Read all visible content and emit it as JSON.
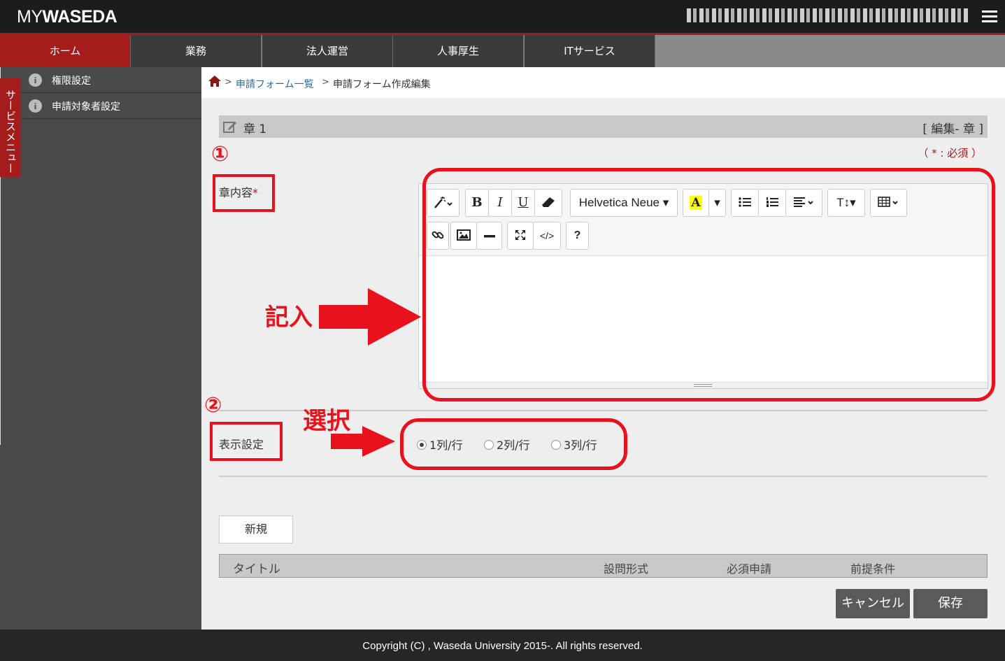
{
  "header": {
    "logo_thin": "MY",
    "logo_bold": "WASEDA"
  },
  "nav": {
    "items": [
      {
        "label": "ホーム",
        "active": true
      },
      {
        "label": "業務"
      },
      {
        "label": "法人運営"
      },
      {
        "label": "人事厚生"
      },
      {
        "label": "ITサービス"
      }
    ]
  },
  "sidebar": {
    "tab_label": "サービスメニュー",
    "items": [
      {
        "label": "権限設定",
        "icon": "info-icon"
      },
      {
        "label": "申請対象者設定",
        "icon": "info-icon"
      }
    ]
  },
  "breadcrumb": {
    "separator": ">",
    "link": "申請フォーム一覧",
    "current": "申請フォーム作成編集"
  },
  "section": {
    "title": "章 1",
    "edit_label": "[ 編集- 章 ]",
    "required_note": "（ * : 必須 ）"
  },
  "form": {
    "chapter_label": "章内容",
    "required_mark": "*",
    "editor": {
      "font_name": "Helvetica Neue",
      "buttons": [
        "magic-icon",
        "B",
        "I",
        "U",
        "eraser-icon",
        "Helvetica Neue",
        "A",
        "ul-icon",
        "ol-icon",
        "align-icon",
        "T↕",
        "table-icon",
        "link-icon",
        "picture-icon",
        "hr-icon",
        "fullscreen-icon",
        "</>",
        "?"
      ]
    },
    "display_label": "表示設定",
    "radio_options": [
      {
        "label": "1列/行",
        "checked": true
      },
      {
        "label": "2列/行",
        "checked": false
      },
      {
        "label": "3列/行",
        "checked": false
      }
    ]
  },
  "annotations": {
    "circle_1": "①",
    "circle_2": "②",
    "write_text": "記入",
    "select_text": "選択",
    "color": "#e8121e"
  },
  "table": {
    "new_button": "新規",
    "headers": [
      "タイトル",
      "設問形式",
      "必須申請",
      "前提条件"
    ]
  },
  "actions": {
    "cancel": "キャンセル",
    "save": "保存"
  },
  "footer": {
    "copyright": "Copyright (C) , Waseda University 2015-. All rights reserved."
  },
  "colors": {
    "brand_red": "#a51c1c",
    "header_bg": "#1c1c1c",
    "link_blue": "#1a6fb0"
  }
}
